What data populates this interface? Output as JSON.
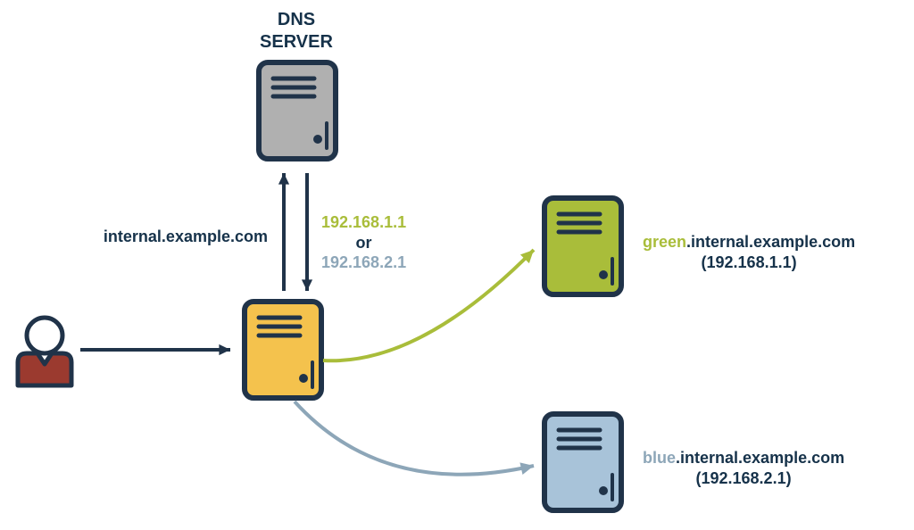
{
  "colors": {
    "navy": "#203349",
    "grey": "#b0b0b0",
    "yellow": "#f4c24d",
    "green": "#a9bd3a",
    "blue": "#a8c3d9",
    "blueText": "#8da6b8",
    "maroon": "#9b3a2f",
    "white": "#ffffff"
  },
  "dns_label": "DNS\nSERVER",
  "query_host": "internal.example.com",
  "dns_responses": {
    "line1": "192.168.1.1",
    "line2": "or",
    "line3": "192.168.2.1"
  },
  "green_server": {
    "prefix": "green",
    "suffix": ".internal.example.com",
    "ip": "(192.168.1.1)"
  },
  "blue_server": {
    "prefix": "blue",
    "suffix": ".internal.example.com",
    "ip": "(192.168.2.1)"
  }
}
